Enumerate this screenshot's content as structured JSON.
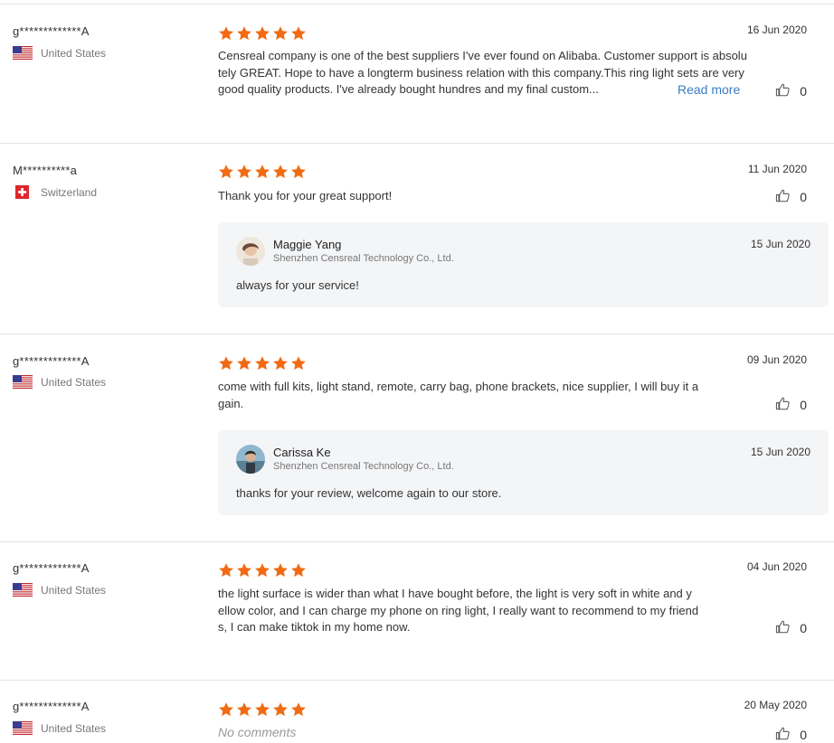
{
  "reviews": [
    {
      "name": "g*************A",
      "country": "United States",
      "flag": "us",
      "rating": 5,
      "date": "16 Jun 2020",
      "lines": [
        "Censreal company is one of the best suppliers I've ever found on Alibaba. Customer support is absolu",
        "tely GREAT. Hope to have a longterm business relation with this company.This ring light sets are very",
        "good quality products. I've already bought hundres and my final custom..."
      ],
      "read_more": "Read more",
      "likes": "0"
    },
    {
      "name": "M**********a",
      "country": "Switzerland",
      "flag": "ch",
      "rating": 5,
      "date": "11 Jun 2020",
      "lines": [
        "Thank you for your great support!"
      ],
      "likes": "0",
      "reply": {
        "name": "Maggie Yang",
        "company": "Shenzhen Censreal Technology Co., Ltd.",
        "date": "15 Jun 2020",
        "text": "always for your service!"
      }
    },
    {
      "name": "g*************A",
      "country": "United States",
      "flag": "us",
      "rating": 5,
      "date": "09 Jun 2020",
      "lines": [
        "come with full kits, light stand, remote, carry bag, phone brackets, nice supplier, I will buy it a",
        "gain."
      ],
      "likes": "0",
      "reply": {
        "name": "Carissa Ke",
        "company": "Shenzhen Censreal Technology Co., Ltd.",
        "date": "15 Jun 2020",
        "text": "thanks for your review, welcome again to our store."
      }
    },
    {
      "name": "g*************A",
      "country": "United States",
      "flag": "us",
      "rating": 5,
      "date": "04 Jun 2020",
      "lines": [
        "the light surface is wider than what I have bought before, the light is very soft in white and y",
        "ellow color, and I can charge my phone on ring light, I really want to recommend to my friend",
        "s, I can make tiktok in my home now."
      ],
      "likes": "0"
    },
    {
      "name": "g*************A",
      "country": "United States",
      "flag": "us",
      "rating": 5,
      "date": "20 May 2020",
      "lines": [
        "No comments"
      ],
      "italic": true,
      "likes": "0"
    }
  ],
  "colors": {
    "star": "#f26a12",
    "link": "#3a7cc4",
    "reply_bg": "#f4f5f7"
  },
  "icons": {
    "like": "thumbs-up-icon",
    "star": "star-icon",
    "flag_us": "us-flag-icon",
    "flag_ch": "swiss-flag-icon"
  }
}
